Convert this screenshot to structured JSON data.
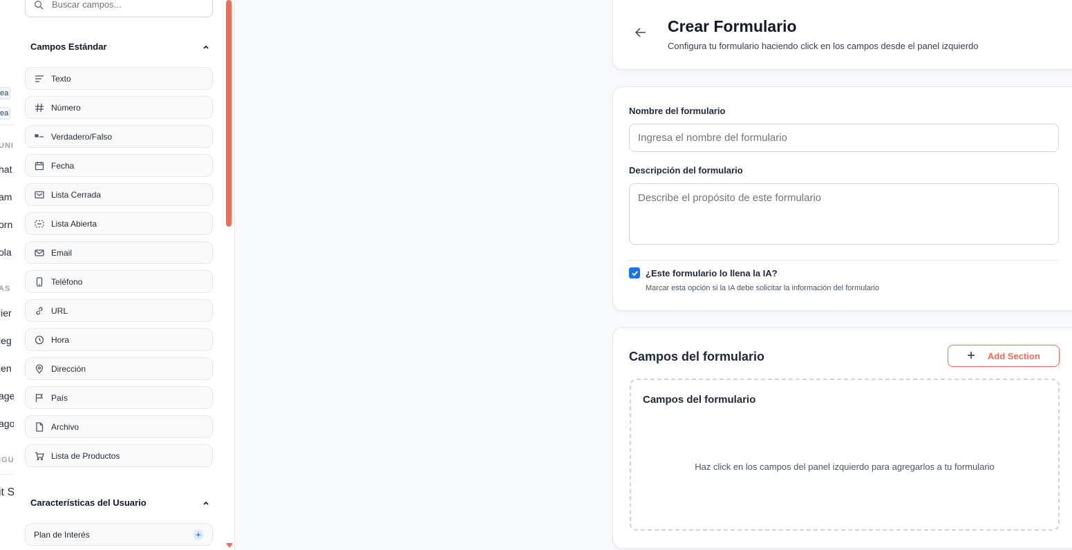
{
  "nav_fragments": {
    "badges": [
      "ea",
      "ea"
    ],
    "items": [
      "UNIC",
      "hat",
      "am",
      "orn",
      "ola",
      "AS Y",
      "lier",
      "leg",
      "ien",
      "age",
      "ago",
      "IGU",
      "it S"
    ]
  },
  "fields_panel": {
    "search_placeholder": "Buscar campos...",
    "standard_group": {
      "title": "Campos Estándar",
      "items": [
        {
          "label": "Texto",
          "icon": "text-lines-icon"
        },
        {
          "label": "Número",
          "icon": "hash-icon"
        },
        {
          "label": "Verdadero/Falso",
          "icon": "toggle-icon"
        },
        {
          "label": "Fecha",
          "icon": "calendar-icon"
        },
        {
          "label": "Lista Cerrada",
          "icon": "list-closed-icon"
        },
        {
          "label": "Lista Abierta",
          "icon": "list-open-icon"
        },
        {
          "label": "Email",
          "icon": "mail-icon"
        },
        {
          "label": "Teléfono",
          "icon": "phone-icon"
        },
        {
          "label": "URL",
          "icon": "link-icon"
        },
        {
          "label": "Hora",
          "icon": "clock-icon"
        },
        {
          "label": "Dirección",
          "icon": "map-pin-icon"
        },
        {
          "label": "País",
          "icon": "flag-icon"
        },
        {
          "label": "Archivo",
          "icon": "file-icon"
        },
        {
          "label": "Lista de Productos",
          "icon": "cart-icon"
        }
      ]
    },
    "user_group": {
      "title": "Características del Usuario",
      "items": [
        {
          "label": "Plan de Interés",
          "icon": "ai-sparkle-icon"
        }
      ]
    }
  },
  "header": {
    "title": "Crear Formulario",
    "subtitle": "Configura tu formulario haciendo click en los campos desde el panel izquierdo"
  },
  "form": {
    "name_label": "Nombre del formulario",
    "name_placeholder": "Ingresa el nombre del formulario",
    "name_value": "",
    "description_label": "Descripción del formulario",
    "description_placeholder": "Describe el propósito de este formulario",
    "description_value": "",
    "ai_fill_label": "¿Este formulario lo llena la IA?",
    "ai_fill_help": "Marcar esta opción si la IA debe solicitar la información del formulario",
    "ai_fill_checked": true
  },
  "form_fields": {
    "title": "Campos del formulario",
    "add_section_label": "Add Section",
    "dropzone_title": "Campos del formulario",
    "empty_message": "Haz click en los campos del panel izquierdo para agregarlos a tu formulario"
  },
  "colors": {
    "accent": "#f26b55",
    "checkbox": "#1a73e8"
  }
}
